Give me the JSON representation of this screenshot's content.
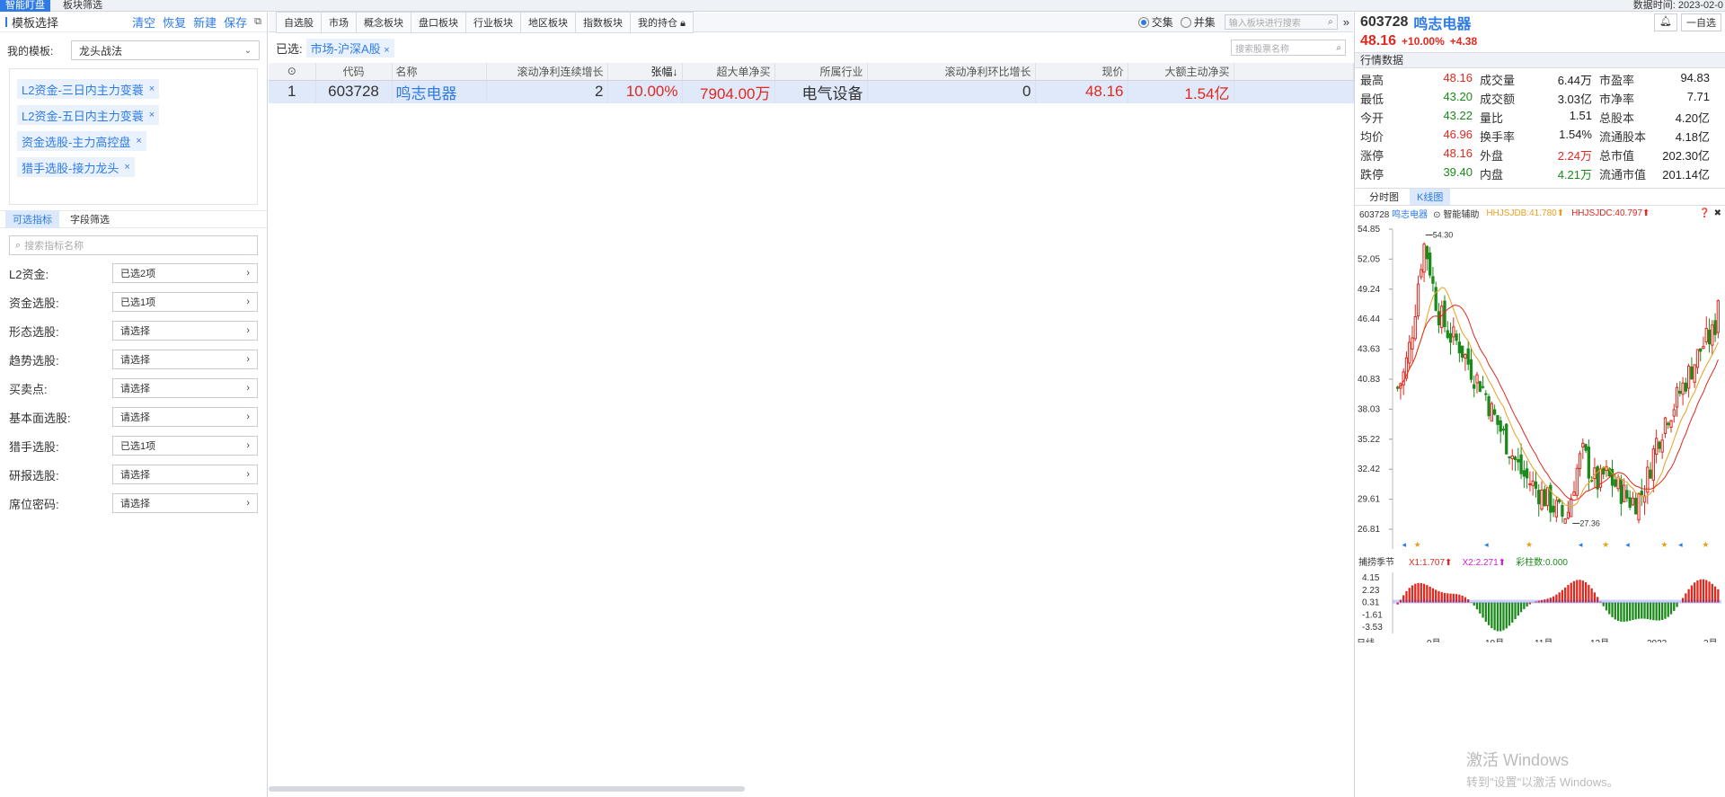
{
  "topbar": {
    "tabs": [
      "智能盯盘",
      "板块筛选"
    ],
    "active": 0,
    "date_label": "数据时间:  2023-02-0"
  },
  "left": {
    "title": "模板选择",
    "actions": [
      "清空",
      "恢复",
      "新建",
      "保存"
    ],
    "template_label": "我的模板:",
    "template_value": "龙头战法",
    "tags": [
      "L2资金-三日内主力变蓑",
      "L2资金-五日内主力变蓑",
      "资金选股-主力高控盘",
      "猎手选股-接力龙头"
    ],
    "filter_tabs": [
      "可选指标",
      "字段筛选"
    ],
    "search_placeholder": "搜索指标名称",
    "filters": [
      {
        "label": "L2资金:",
        "value": "已选2项"
      },
      {
        "label": "资金选股:",
        "value": "已选1项"
      },
      {
        "label": "形态选股:",
        "value": "请选择"
      },
      {
        "label": "趋势选股:",
        "value": "请选择"
      },
      {
        "label": "买卖点:",
        "value": "请选择"
      },
      {
        "label": "基本面选股:",
        "value": "请选择"
      },
      {
        "label": "猎手选股:",
        "value": "已选1项"
      },
      {
        "label": "研报选股:",
        "value": "请选择"
      },
      {
        "label": "席位密码:",
        "value": "请选择"
      }
    ]
  },
  "main": {
    "tabs": [
      "自选股",
      "市场",
      "概念板块",
      "盘口板块",
      "行业板块",
      "地区板块",
      "指数板块",
      "我的持仓"
    ],
    "radio": {
      "a": "交集",
      "b": "并集"
    },
    "block_search_placeholder": "输入板块进行搜索",
    "selected_label": "已选:",
    "selected_tag": "市场-沪深A股",
    "stock_search_placeholder": "搜索股票名称",
    "columns": [
      "代码",
      "名称",
      "滚动净利连续增长",
      "张幅↓",
      "超大单净买",
      "所属行业",
      "滚动净利环比增长",
      "现价",
      "大额主动净买"
    ],
    "rows": [
      {
        "idx": "1",
        "code": "603728",
        "name": "鸣志电器",
        "growth": "2",
        "change": "10.00%",
        "bignet": "7904.00万",
        "industry": "电气设备",
        "ratio": "0",
        "price": "48.16",
        "active_net": "1.54亿"
      }
    ]
  },
  "quote": {
    "code": "603728",
    "name": "鸣志电器",
    "buttons": [
      "一自选"
    ],
    "price": "48.16",
    "pct": "+10.00%",
    "chg": "+4.38",
    "section": "行情数据",
    "stats": [
      [
        "最高",
        "48.16",
        "red",
        "成交量",
        "6.44万",
        "",
        "市盈率",
        "94.83",
        ""
      ],
      [
        "最低",
        "43.20",
        "green",
        "成交额",
        "3.03亿",
        "",
        "市净率",
        "7.71",
        ""
      ],
      [
        "今开",
        "43.22",
        "green",
        "量比",
        "1.51",
        "",
        "总股本",
        "4.20亿",
        ""
      ],
      [
        "均价",
        "46.96",
        "red",
        "换手率",
        "1.54%",
        "",
        "流通股本",
        "4.18亿",
        ""
      ],
      [
        "涨停",
        "48.16",
        "red",
        "外盘",
        "2.24万",
        "red",
        "总市值",
        "202.30亿",
        ""
      ],
      [
        "跌停",
        "39.40",
        "green",
        "内盘",
        "4.21万",
        "green",
        "流通市值",
        "201.14亿",
        ""
      ]
    ],
    "chart_tabs": [
      "分时图",
      "K线图"
    ],
    "chart_active": 1
  },
  "chart_data": [
    {
      "type": "candlestick",
      "title": "603728 鸣志电器",
      "assist_label": "智能辅助",
      "indicators": [
        {
          "name": "HHJSJDB",
          "value": "41.780",
          "color": "#e8a020"
        },
        {
          "name": "HHJSJDC",
          "value": "40.797",
          "color": "#e0281e"
        }
      ],
      "y_ticks": [
        54.85,
        52.05,
        49.24,
        46.44,
        43.63,
        40.83,
        38.03,
        35.22,
        32.42,
        29.61,
        26.81
      ],
      "ylim": [
        26.81,
        54.85
      ],
      "high_mark": "54.30",
      "low_mark": "27.36",
      "x_ticks": [
        "日线",
        "9月",
        "10月",
        "11月",
        "12月",
        "2023",
        "2月"
      ],
      "trend_close": [
        40,
        41,
        43,
        46,
        50,
        53.5,
        52,
        49,
        47,
        46,
        45,
        44.5,
        44,
        43,
        42,
        41,
        40.5,
        39.5,
        38,
        37,
        36,
        35,
        34,
        33,
        32,
        31.5,
        31,
        30.5,
        30,
        29.5,
        29,
        28.5,
        28,
        28.5,
        31,
        33,
        34,
        32.5,
        31.5,
        31,
        32,
        31.5,
        31,
        30.5,
        30,
        29.5,
        29.5,
        30,
        31,
        33,
        35,
        36,
        37.5,
        38,
        39,
        40,
        41,
        42,
        43,
        44,
        44.5,
        45,
        47
      ]
    },
    {
      "type": "bar",
      "title": "捕捞季节",
      "labels": [
        {
          "text": "X1:1.707",
          "color": "#e0281e"
        },
        {
          "text": "X2:2.271",
          "color": "#d020d0"
        },
        {
          "text": "彩柱数:0.000",
          "color": "#1a8a1a"
        }
      ],
      "y_ticks": [
        4.15,
        2.23,
        0.31,
        -1.61,
        -3.53
      ],
      "ylim": [
        -4.5,
        5.0
      ]
    }
  ],
  "watermark": {
    "line1": "激活 Windows",
    "line2": "转到\"设置\"以激活 Windows。"
  }
}
